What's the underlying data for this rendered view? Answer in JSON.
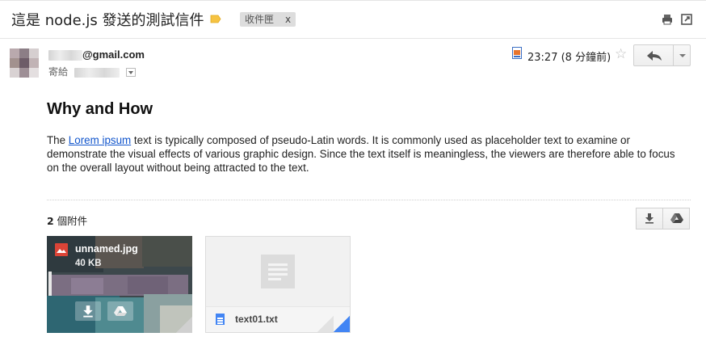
{
  "header": {
    "subject": "這是 node.js 發送的測試信件",
    "inbox_label": "收件匣",
    "inbox_remove": "x",
    "label_color": "#f6c342",
    "icons": [
      "print-icon",
      "new-window-icon"
    ]
  },
  "message": {
    "sender_suffix": "@gmail.com",
    "to_prefix": "寄給",
    "time": "23:27 (8 分鐘前)",
    "actions": [
      "star-icon",
      "reply-icon",
      "more-options-icon"
    ]
  },
  "body": {
    "heading": "Why and How",
    "para_before_link": "The ",
    "link_text": "Lorem ipsum",
    "para_after_link": " text is typically composed of pseudo-Latin words. It is commonly used as placeholder text to examine or demonstrate the visual effects of various graphic design. Since the text itself is meaningless, the viewers are therefore able to focus on the overall layout without being attracted to the text.",
    "link_color": "#1155cc"
  },
  "attachments": {
    "count_num": "2",
    "count_label": " 個附件",
    "items": [
      {
        "name": "unnamed.jpg",
        "size": "40 KB",
        "type_icon": "image-icon"
      },
      {
        "name": "text01.txt",
        "type_icon": "document-icon"
      }
    ],
    "accent_blue": "#4285f4",
    "image_red": "#db4437"
  }
}
